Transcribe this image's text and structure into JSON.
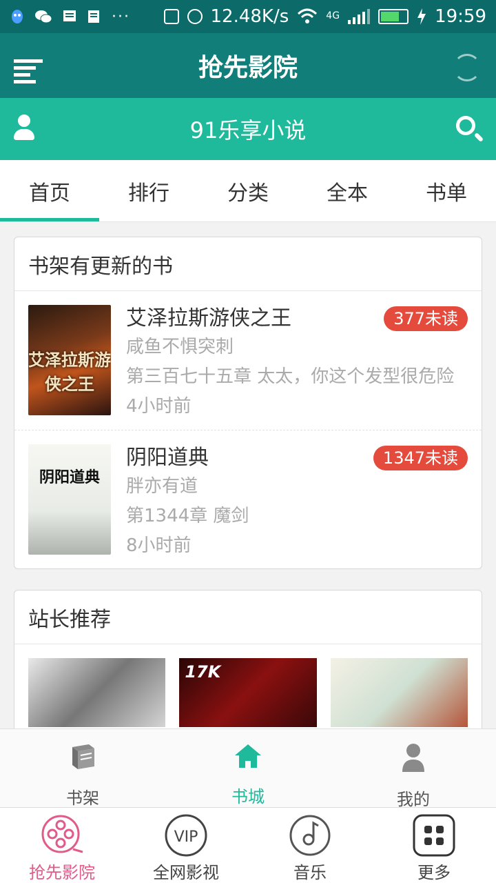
{
  "status_bar": {
    "speed": "12.48K/s",
    "network": "4G",
    "time": "19:59",
    "dots": "···"
  },
  "titlebar": {
    "title": "抢先影院"
  },
  "appbar": {
    "title": "91乐享小说"
  },
  "tabs": [
    {
      "label": "首页",
      "active": true
    },
    {
      "label": "排行",
      "active": false
    },
    {
      "label": "分类",
      "active": false
    },
    {
      "label": "全本",
      "active": false
    },
    {
      "label": "书单",
      "active": false
    }
  ],
  "shelf": {
    "heading": "书架有更新的书",
    "books": [
      {
        "title": "艾泽拉斯游侠之王",
        "author": "咸鱼不惧突刺",
        "latest": "第三百七十五章 太太，你这个发型很危险",
        "time": "4小时前",
        "unread": "377未读",
        "cover_text": "艾泽拉斯游侠之王"
      },
      {
        "title": "阴阳道典",
        "author": "胖亦有道",
        "latest": "第1344章 魔剑",
        "time": "8小时前",
        "unread": "1347未读",
        "cover_text": "阴阳道典"
      }
    ]
  },
  "recommend": {
    "heading": "站长推荐",
    "r2_label": "17K"
  },
  "inner_nav": [
    {
      "label": "书架",
      "active": false
    },
    {
      "label": "书城",
      "active": true
    },
    {
      "label": "我的",
      "active": false
    }
  ],
  "outer_nav": [
    {
      "label": "抢先影院",
      "active": true
    },
    {
      "label": "全网影视",
      "active": false,
      "icon_text": "VIP"
    },
    {
      "label": "音乐",
      "active": false
    },
    {
      "label": "更多",
      "active": false
    }
  ],
  "colors": {
    "status_bar": "#0c6b68",
    "title_bar": "#117e79",
    "accent": "#1fb99b",
    "badge": "#e44b3c",
    "outer_active": "#e05a8a"
  }
}
